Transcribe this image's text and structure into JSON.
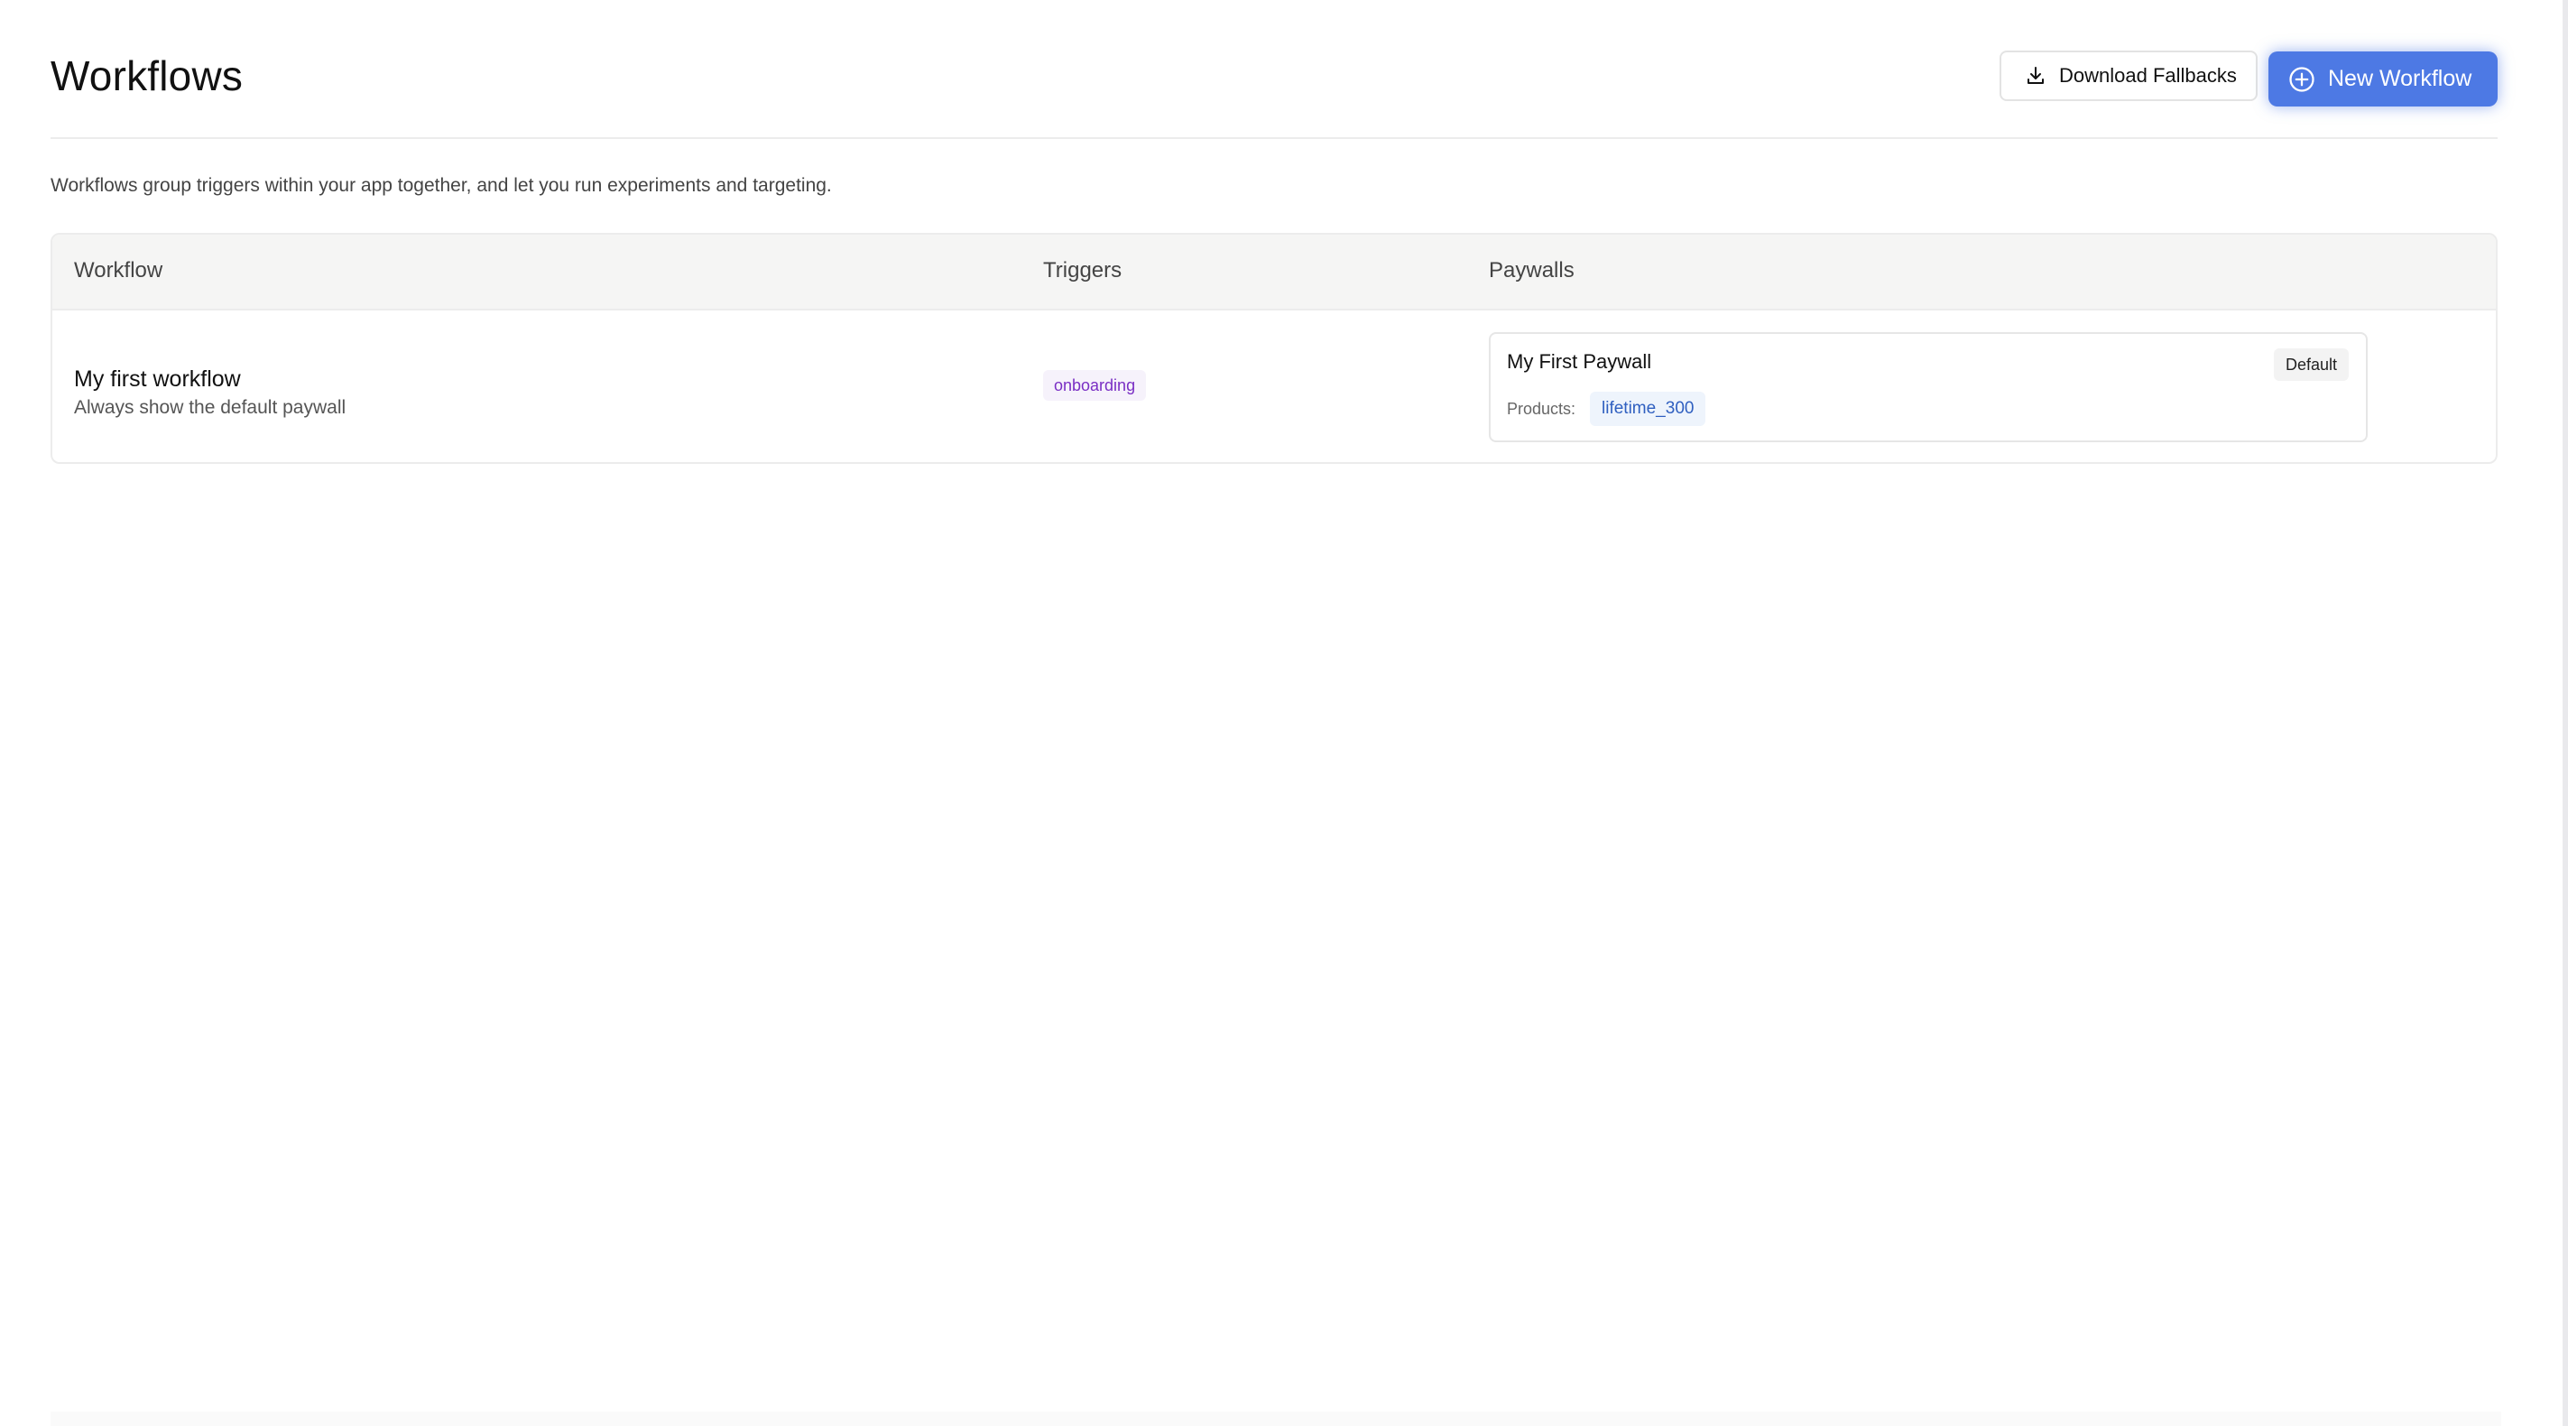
{
  "header": {
    "title": "Workflows",
    "download_label": "Download Fallbacks",
    "new_label": "New Workflow"
  },
  "description": "Workflows group triggers within your app together, and let you run experiments and targeting.",
  "table": {
    "columns": [
      "Workflow",
      "Triggers",
      "Paywalls"
    ],
    "rows": [
      {
        "name": "My first workflow",
        "description": "Always show the default paywall",
        "triggers": [
          "onboarding"
        ],
        "paywalls": [
          {
            "name": "My First Paywall",
            "badge": "Default",
            "products_label": "Products:",
            "products": [
              "lifetime_300"
            ]
          }
        ]
      }
    ]
  },
  "icons": {
    "download": "download-icon",
    "new": "plus-circle-icon"
  },
  "colors": {
    "accent": "#4d79e4",
    "trigger_text": "#7a2fc4",
    "trigger_bg": "#f6f2fb",
    "product_text": "#2f5fc0",
    "product_bg": "#eef4fc"
  }
}
